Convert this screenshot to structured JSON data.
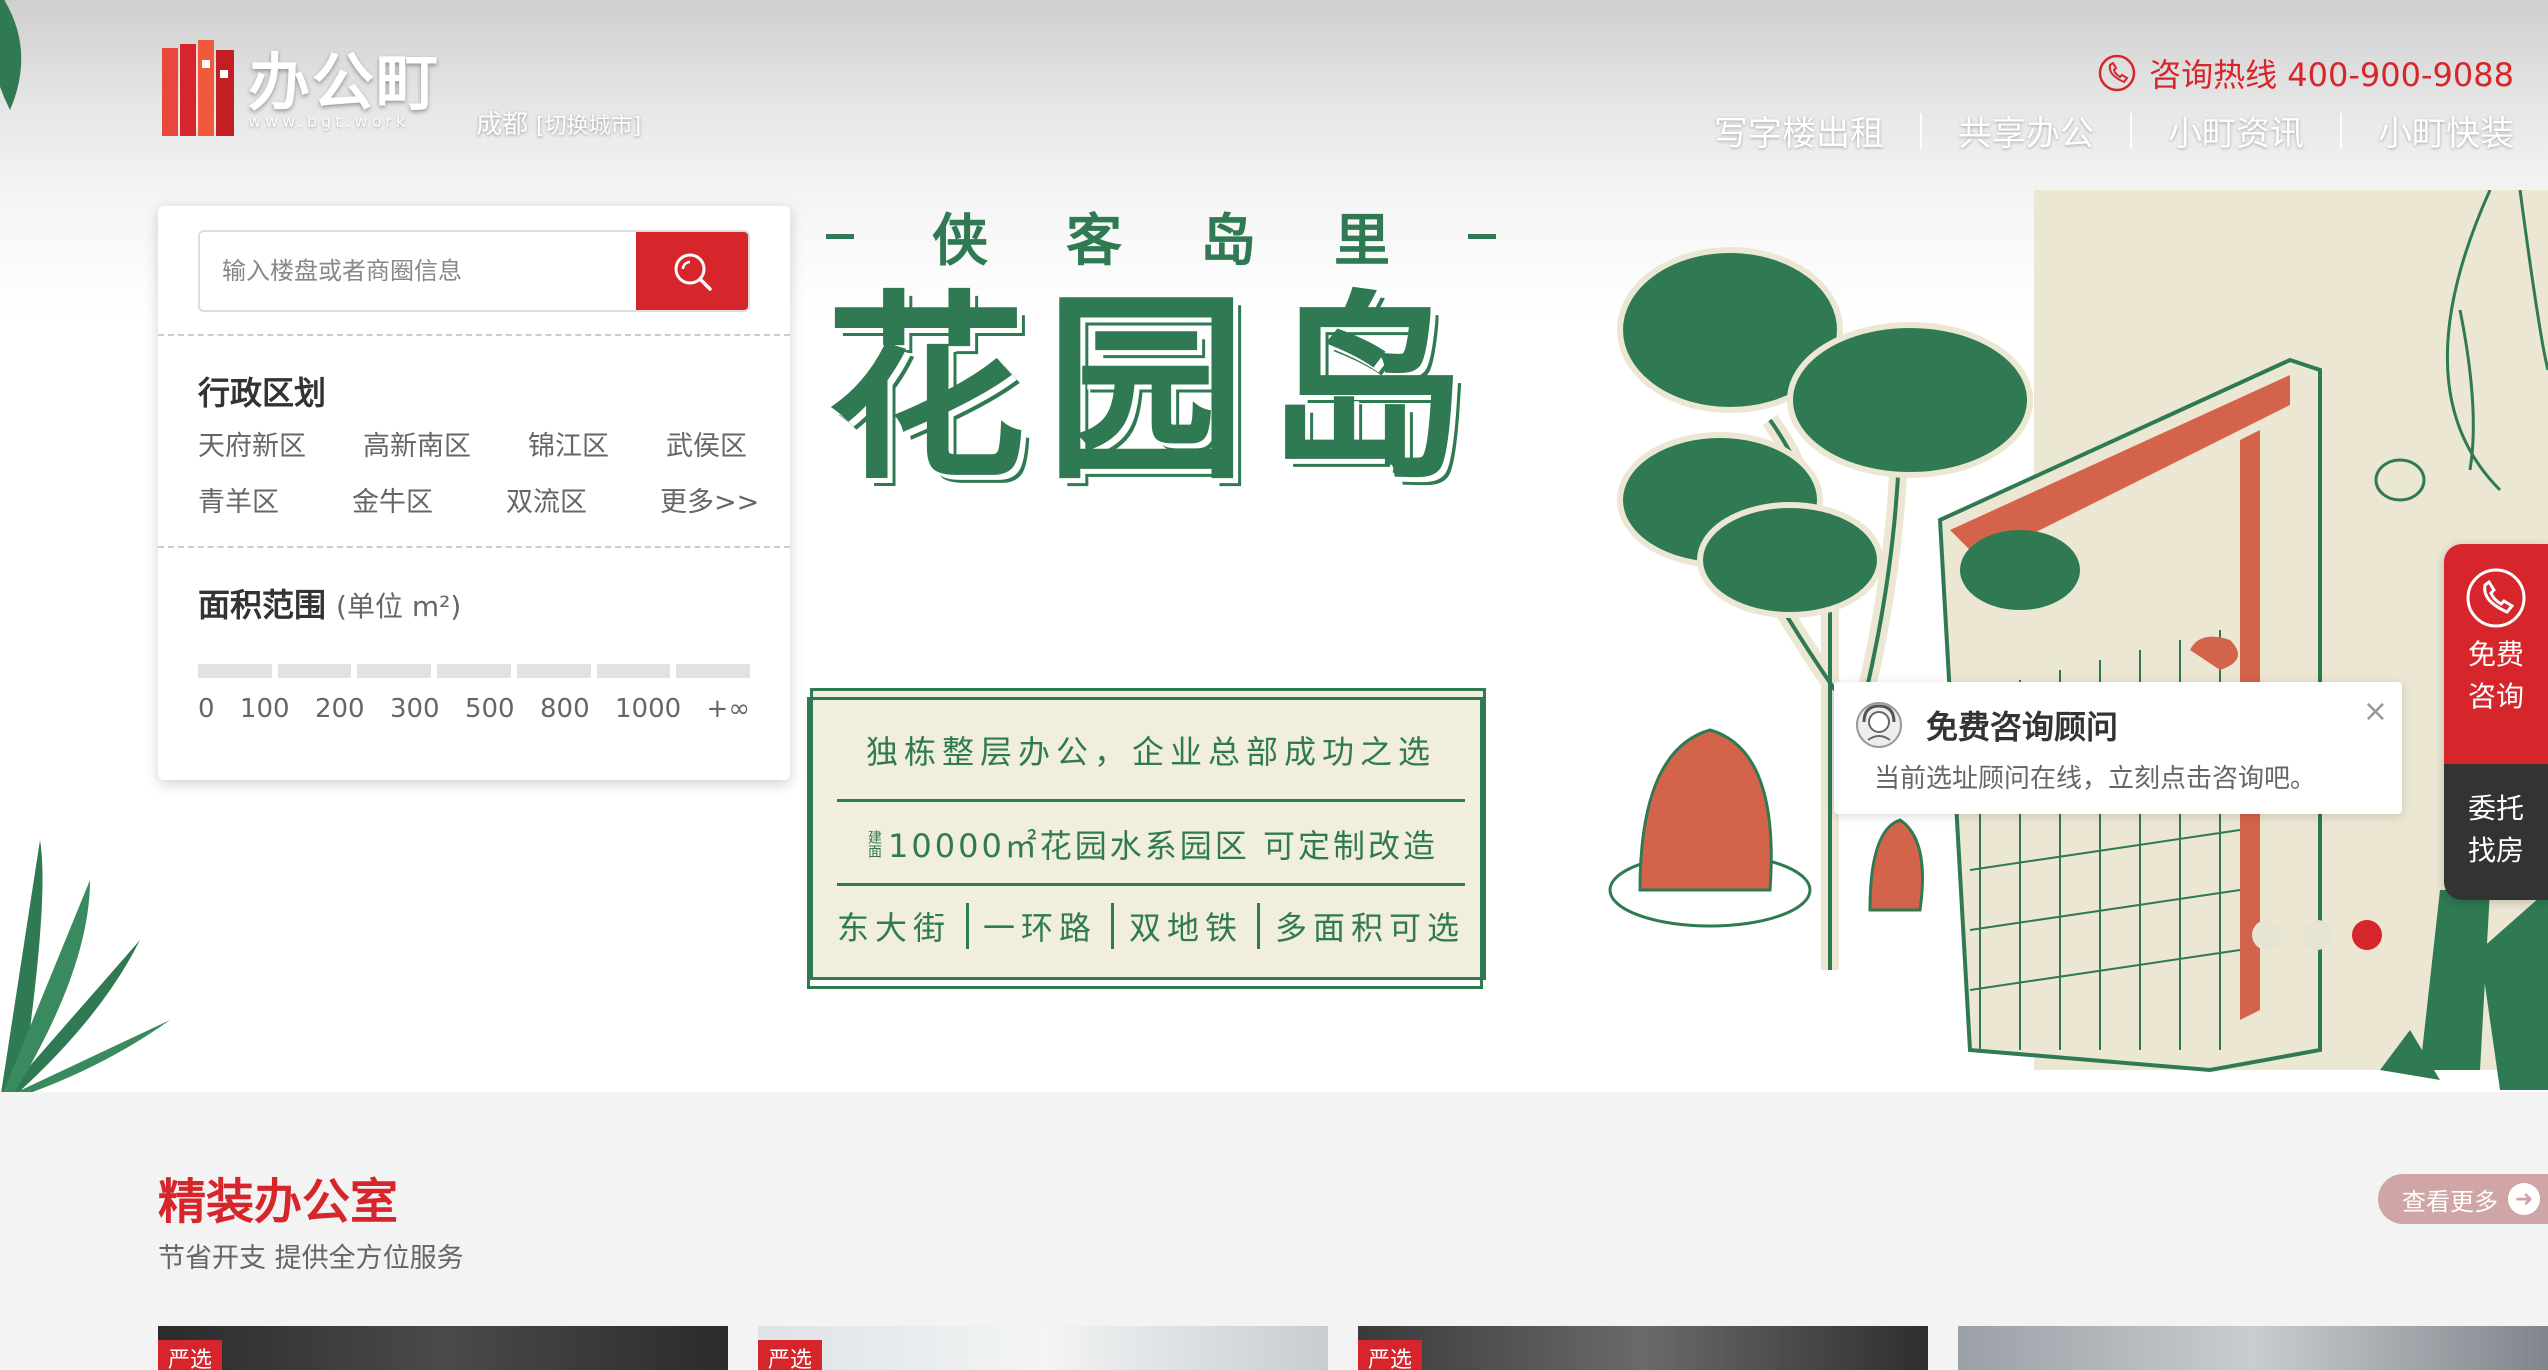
{
  "header": {
    "logo_name": "办公町",
    "logo_url": "www.bgt.work",
    "city": "成都",
    "city_switch": "[切换城市]",
    "hotline": "咨询热线 400-900-9088",
    "nav": [
      "写字楼出租",
      "共享办公",
      "小町资讯",
      "小町快装"
    ]
  },
  "search": {
    "placeholder": "输入楼盘或者商圈信息",
    "district_title": "行政区划",
    "districts": [
      "天府新区",
      "高新南区",
      "锦江区",
      "武侯区",
      "青羊区",
      "金牛区",
      "双流区",
      "更多>>"
    ],
    "area_title": "面积范围",
    "area_unit": "(单位 m²)",
    "area_ranges": [
      "0",
      "100",
      "200",
      "300",
      "500",
      "800",
      "1000",
      "+∞"
    ]
  },
  "banner": {
    "subtitle": [
      "侠",
      "客",
      "岛",
      "里"
    ],
    "title": "花园岛",
    "line1": "独栋整层办公，企业总部成功之选",
    "line2_prefix": "建面",
    "line2": "10000㎡花园水系园区 可定制改造",
    "line3": [
      "东大街",
      "一环路",
      "双地铁",
      "多面积可选"
    ],
    "colors": {
      "green": "#2f7a52",
      "cream": "#f1eedb",
      "brick": "#d4634b"
    }
  },
  "consult_popup": {
    "title": "免费咨询顾问",
    "text": "当前选址顾问在线，立刻点击咨询吧。",
    "close": "×"
  },
  "carousel": {
    "count": 3,
    "active": 3
  },
  "float_bar": {
    "free_consult": [
      "免费",
      "咨询"
    ],
    "entrust": [
      "委托",
      "找房"
    ]
  },
  "section": {
    "title": "精装办公室",
    "subtitle": "节省开支 提供全方位服务",
    "more": "查看更多",
    "card_badge": "严选"
  },
  "accent": "#d6262b"
}
